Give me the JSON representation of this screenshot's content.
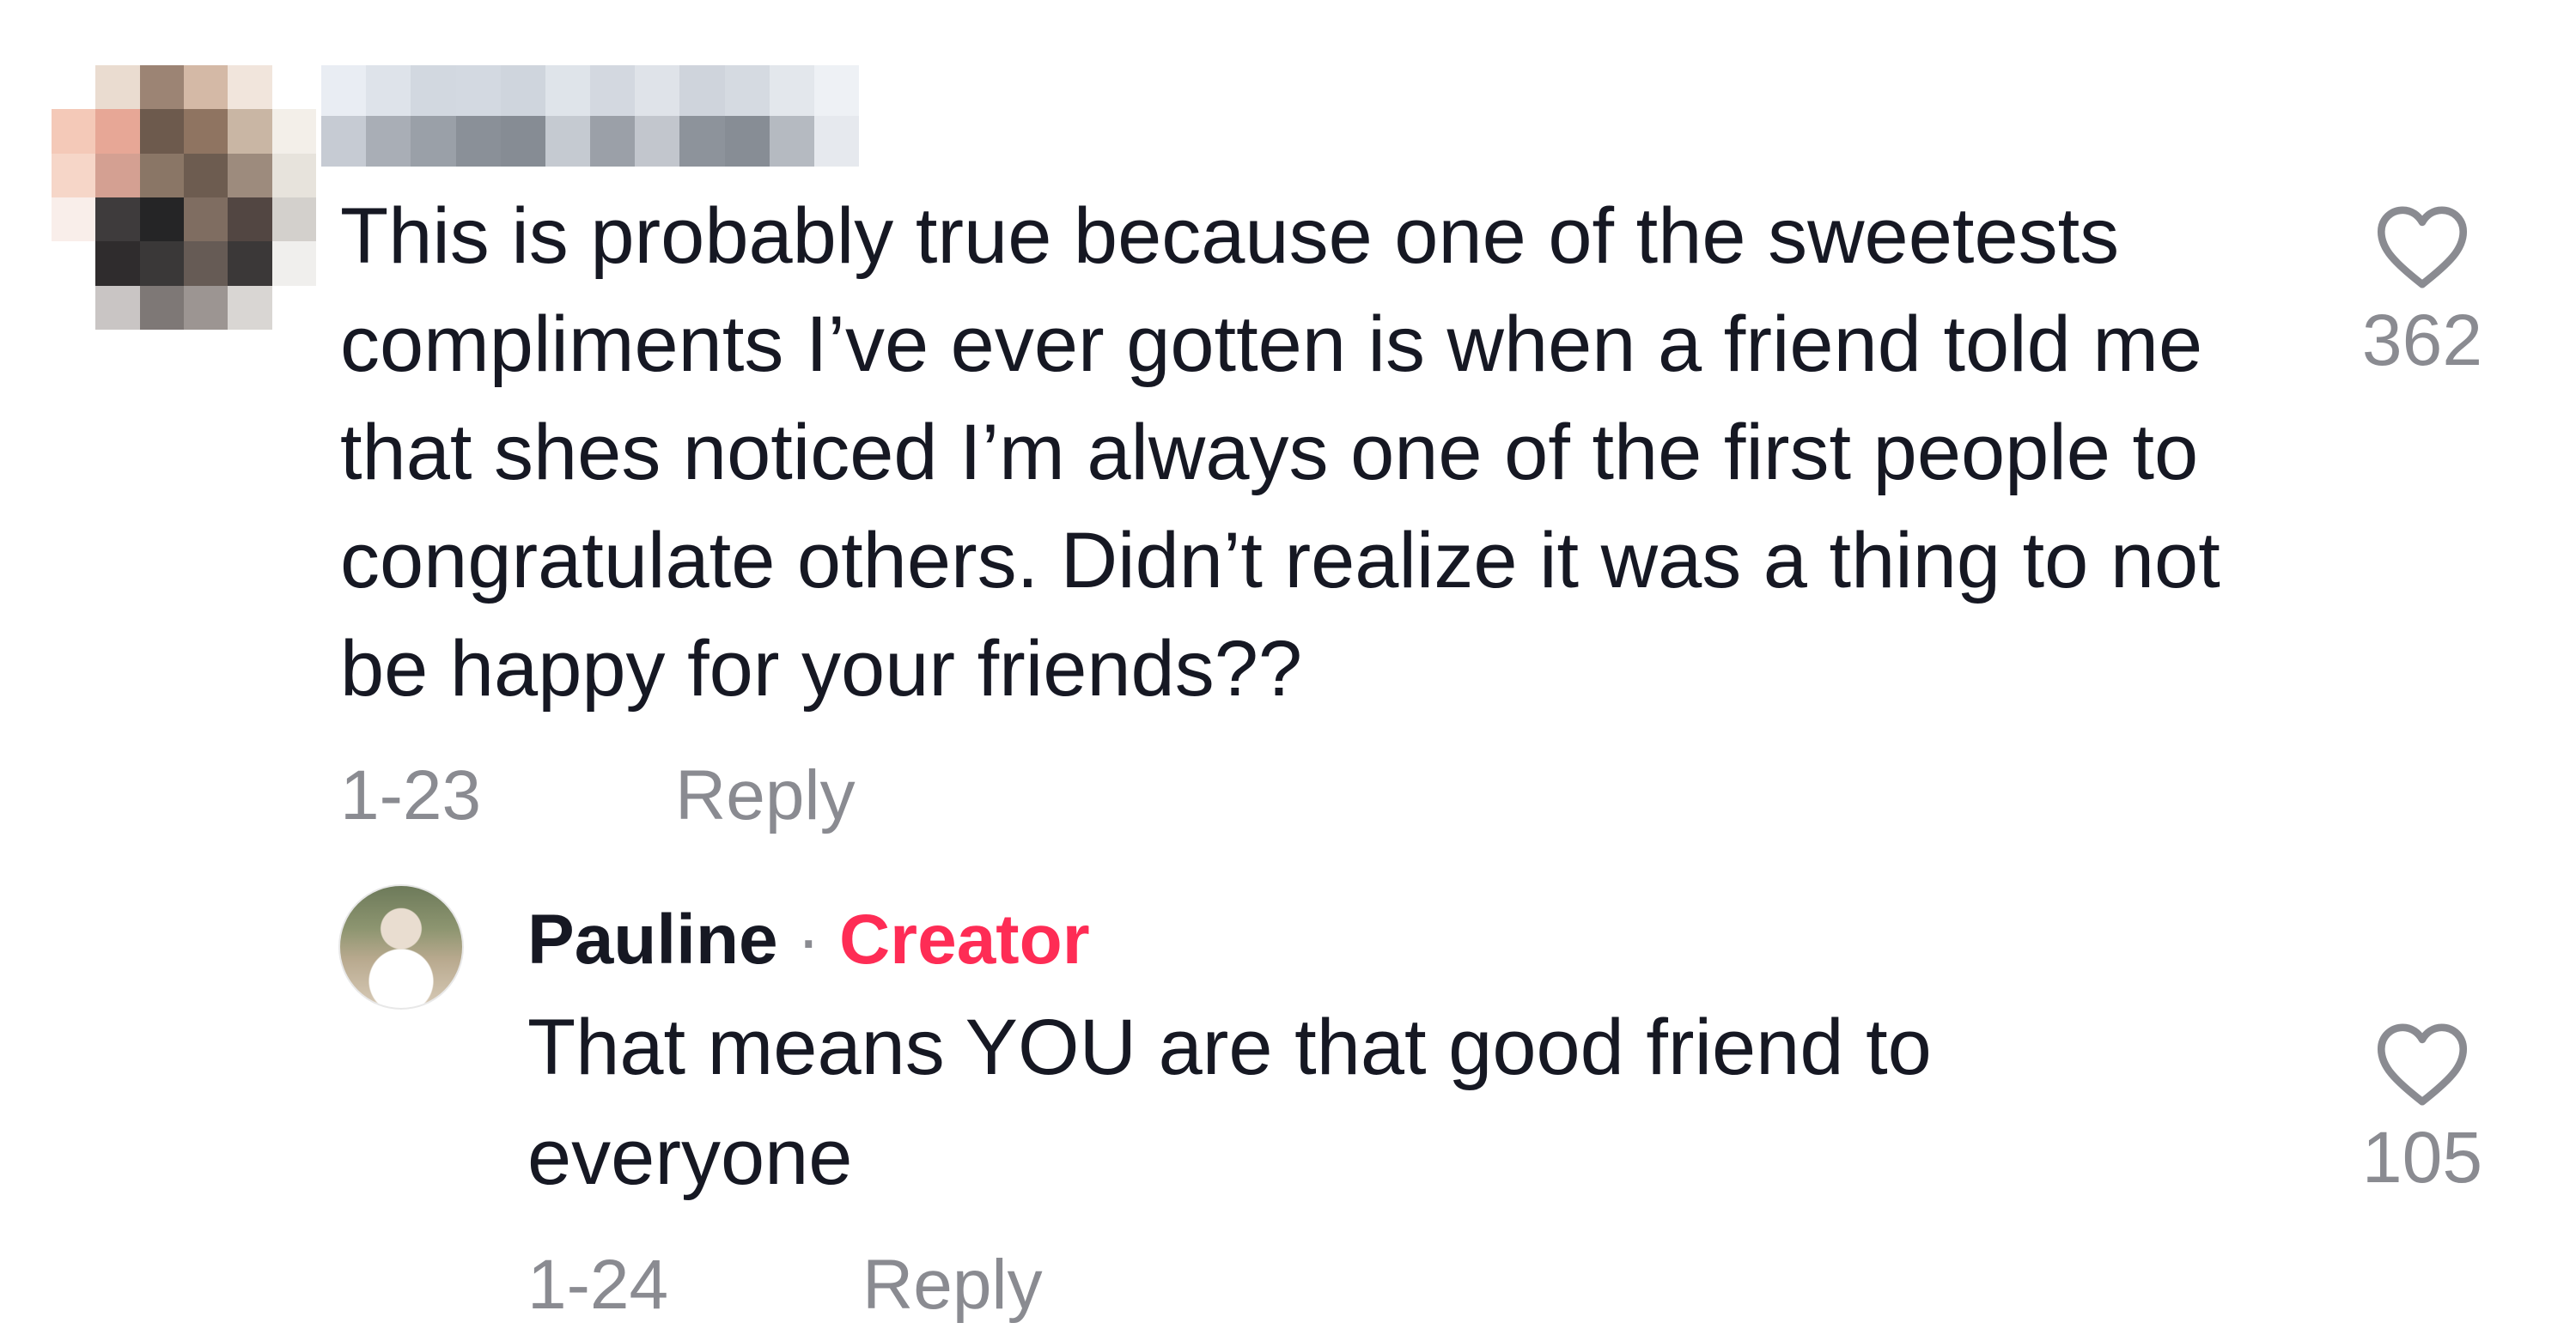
{
  "comment": {
    "text": "This is probably true because one of the sweetests compliments I’ve ever gotten is when a friend told me that shes noticed I’m always one of the first people to congratulate others. Didn’t realize it was a thing to not be happy for your friends??",
    "date": "1-23",
    "reply_label": "Reply",
    "like_count": "362",
    "avatar_pixels": [
      "#ffffff",
      "#eadcd0",
      "#9c8474",
      "#d4b9a6",
      "#f1e5dc",
      "#ffffff",
      "#f4c9b8",
      "#e7a796",
      "#6d5a4d",
      "#8f7461",
      "#c9b6a4",
      "#f3efe9",
      "#f6d6c8",
      "#d4a092",
      "#8a7666",
      "#6d5c50",
      "#9d8b7d",
      "#e7e3dc",
      "#f9eeea",
      "#3e3b3c",
      "#252526",
      "#7f6d61",
      "#524642",
      "#d3d0cc",
      "#ffffff",
      "#2f2c2d",
      "#3a3838",
      "#665b55",
      "#3b3838",
      "#f0efed",
      "#ffffff",
      "#c9c5c4",
      "#7e7876",
      "#9c9592",
      "#d9d6d3",
      "#ffffff"
    ],
    "username_pixels": [
      "#e9edf3",
      "#dee3ea",
      "#d2d8e0",
      "#d3d9e1",
      "#cfd5dd",
      "#dfe4ea",
      "#d3d8e0",
      "#dfe3e9",
      "#cfd4dc",
      "#d5dae1",
      "#e3e7ec",
      "#eef1f5",
      "#c6cbd3",
      "#a9aeb6",
      "#9aa0a8",
      "#8a9098",
      "#868c94",
      "#c5cad1",
      "#9ba0a8",
      "#c2c6cd",
      "#8d939b",
      "#878d95",
      "#b5bac1",
      "#e6e9ee"
    ]
  },
  "reply": {
    "author": "Pauline",
    "separator": "·",
    "badge": "Creator",
    "text": "That means YOU are that good friend to everyone",
    "date": "1-24",
    "reply_label": "Reply",
    "like_count": "105"
  },
  "colors": {
    "text": "#161823",
    "secondary": "#8a8b91",
    "creator_badge": "#fe2c55"
  }
}
